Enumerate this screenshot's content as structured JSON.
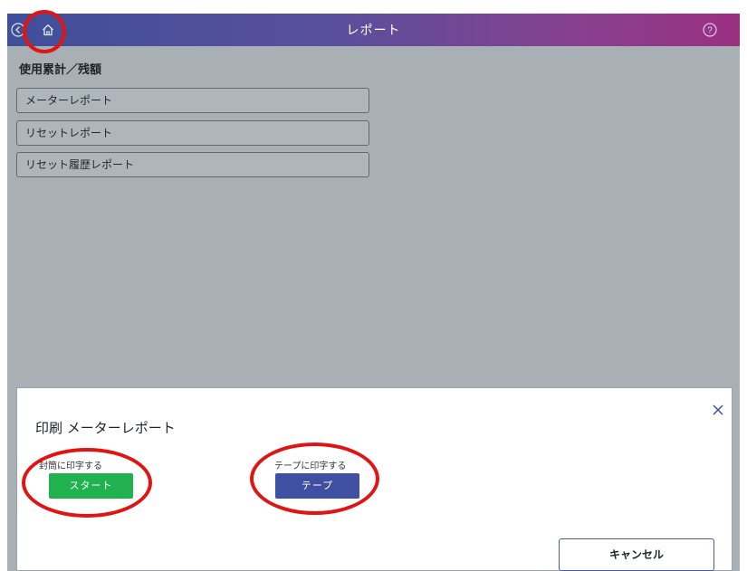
{
  "header": {
    "title": "レポート",
    "back_icon": "back-circle-icon",
    "home_icon": "home-icon",
    "help_icon": "help-circle-icon",
    "gradient_start": "#3f4f9a",
    "gradient_end": "#9a2f82"
  },
  "section": {
    "title": "使用累計／残額"
  },
  "reports": [
    {
      "label": "メーターレポート"
    },
    {
      "label": "リセットレポート"
    },
    {
      "label": "リセット履歴レポート"
    }
  ],
  "modal": {
    "title": "印刷 メーターレポート",
    "envelope_caption": "封筒に印字する",
    "start_label": "スタート",
    "tape_caption": "テープに印字する",
    "tape_label": "テープ",
    "cancel_label": "キャンセル",
    "close_icon": "close-icon"
  },
  "colors": {
    "start_button": "#21b14f",
    "tape_button": "#3f50a3",
    "annotation_ring": "#e11414",
    "background_overlay": "#a8b0b6"
  }
}
